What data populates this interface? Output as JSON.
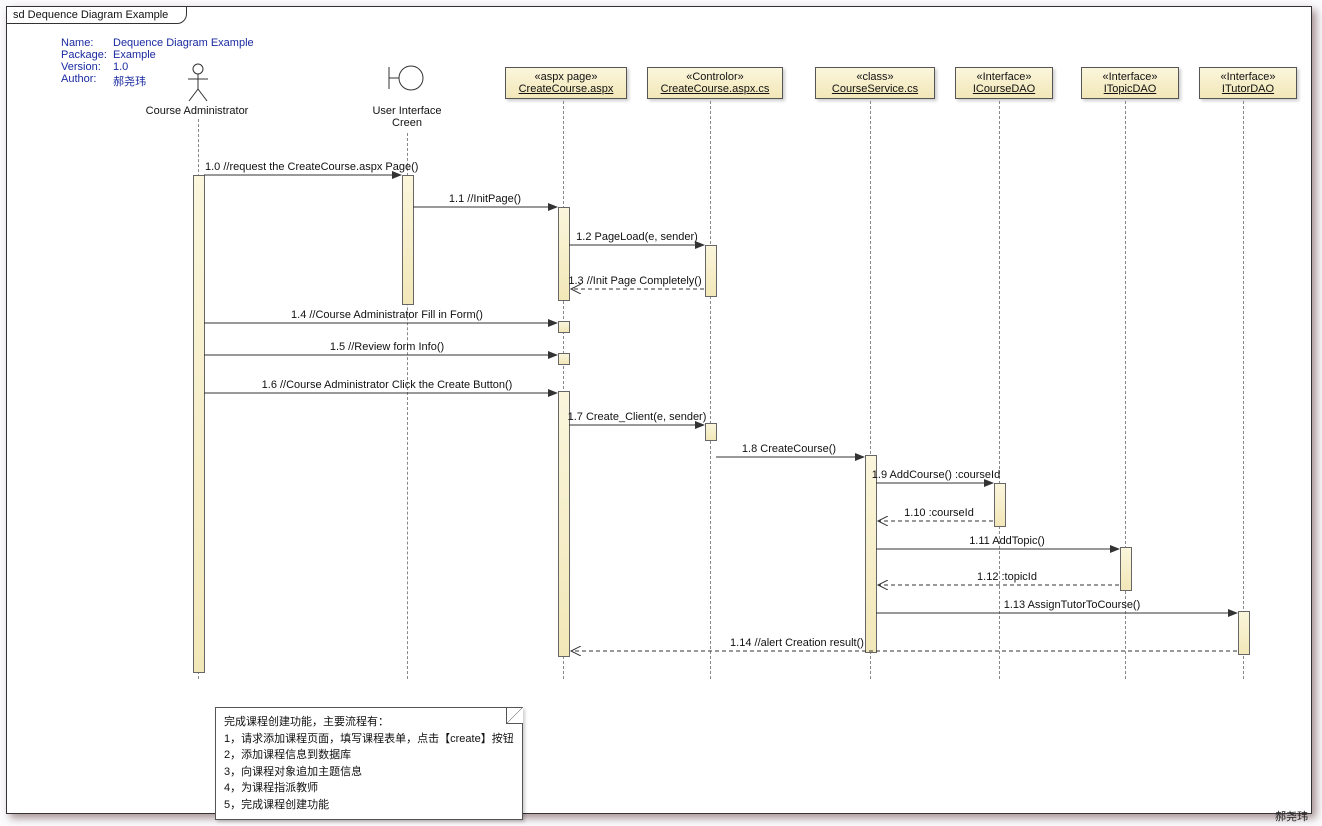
{
  "frame_title": "sd Dequence Diagram Example",
  "meta": {
    "name_label": "Name:",
    "name_value": "Dequence Diagram Example",
    "package_label": "Package:",
    "package_value": "Example",
    "version_label": "Version:",
    "version_value": "1.0",
    "author_label": "Author:",
    "author_value": "郝尧玮"
  },
  "lifelines": {
    "actor": "Course Administrator",
    "ui": "User Interface\nCreen",
    "aspx_stereo": "«aspx page»",
    "aspx_name": "CreateCourse.aspx",
    "ctrl_stereo": "«Controlor»",
    "ctrl_name": "CreateCourse.aspx.cs",
    "svc_stereo": "«class»",
    "svc_name": "CourseService.cs",
    "dao1_stereo": "«Interface»",
    "dao1_name": "ICourseDAO",
    "dao2_stereo": "«Interface»",
    "dao2_name": "ITopicDAO",
    "dao3_stereo": "«Interface»",
    "dao3_name": "ITutorDAO"
  },
  "messages": {
    "m1": "1.0 //request the CreateCourse.aspx Page()",
    "m2": "1.1 //InitPage()",
    "m3": "1.2 PageLoad(e, sender)",
    "m4": "1.3 //Init Page Completely()",
    "m5": "1.4 //Course Administrator Fill in  Form()",
    "m6": "1.5 //Review  form Info()",
    "m7": "1.6 //Course Administrator Click the Create Button()",
    "m8": "1.7 Create_Client(e, sender)",
    "m9": "1.8 CreateCourse()",
    "m10": "1.9 AddCourse() :courseId",
    "m11": "1.10  :courseId",
    "m12": "1.11 AddTopic()",
    "m13": "1.12  :topicId",
    "m14": "1.13 AssignTutorToCourse()",
    "m15": "1.14 //alert Creation result()"
  },
  "note": {
    "l1": "完成课程创建功能，主要流程有：",
    "l2": "1，请求添加课程页面，填写课程表单，点击【create】按钮",
    "l3": "2，添加课程信息到数据库",
    "l4": "3，向课程对象追加主题信息",
    "l5": "4，为课程指派教师",
    "l6": "5，完成课程创建功能"
  },
  "credit": "郝尧玮"
}
